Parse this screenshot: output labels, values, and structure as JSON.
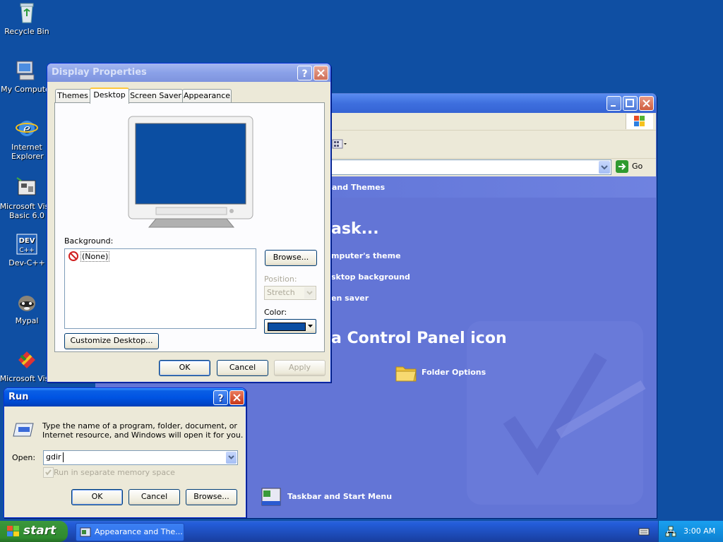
{
  "desktop": {
    "icons": [
      {
        "label": "Recycle Bin",
        "icon": "recycle-bin-icon"
      },
      {
        "label": "My Compute",
        "icon": "my-computer-icon"
      },
      {
        "label": "Internet Explorer",
        "icon": "internet-explorer-icon"
      },
      {
        "label": "Microsoft Visu Basic 6.0",
        "icon": "visual-basic-icon"
      },
      {
        "label": "Dev-C++",
        "icon": "dev-cpp-icon"
      },
      {
        "label": "Mypal",
        "icon": "mypal-icon"
      },
      {
        "label": "Microsoft Visu",
        "icon": "visual-studio-icon"
      }
    ]
  },
  "control_panel": {
    "address_go": "Go",
    "category_title": "and Themes",
    "pick_task": "ask...",
    "tasks": [
      "mputer's theme",
      "sktop background",
      "en saver"
    ],
    "pick_icon": "a Control Panel icon",
    "icons": [
      {
        "label": "Folder Options",
        "icon": "folder-options-icon"
      },
      {
        "label": "Taskbar and Start Menu",
        "icon": "taskbar-icon"
      }
    ]
  },
  "display_properties": {
    "title": "Display Properties",
    "tabs": [
      "Themes",
      "Desktop",
      "Screen Saver",
      "Appearance"
    ],
    "selected_tab": "Desktop",
    "background_label": "Background:",
    "background_items": [
      "(None)"
    ],
    "browse": "Browse...",
    "position_label": "Position:",
    "position_value": "Stretch",
    "color_label": "Color:",
    "color_value": "#0b4ea2",
    "customize": "Customize Desktop...",
    "ok": "OK",
    "cancel": "Cancel",
    "apply": "Apply"
  },
  "run_dialog": {
    "title": "Run",
    "description_line1": "Type the name of a program, folder, document, or",
    "description_line2": "Internet resource, and Windows will open it for you.",
    "open_label": "Open:",
    "open_value": "gdir",
    "checkbox_label": "Run in separate memory space",
    "ok": "OK",
    "cancel": "Cancel",
    "browse": "Browse..."
  },
  "taskbar": {
    "start": "start",
    "task_button": "Appearance and The...",
    "clock": "3:00 AM"
  }
}
